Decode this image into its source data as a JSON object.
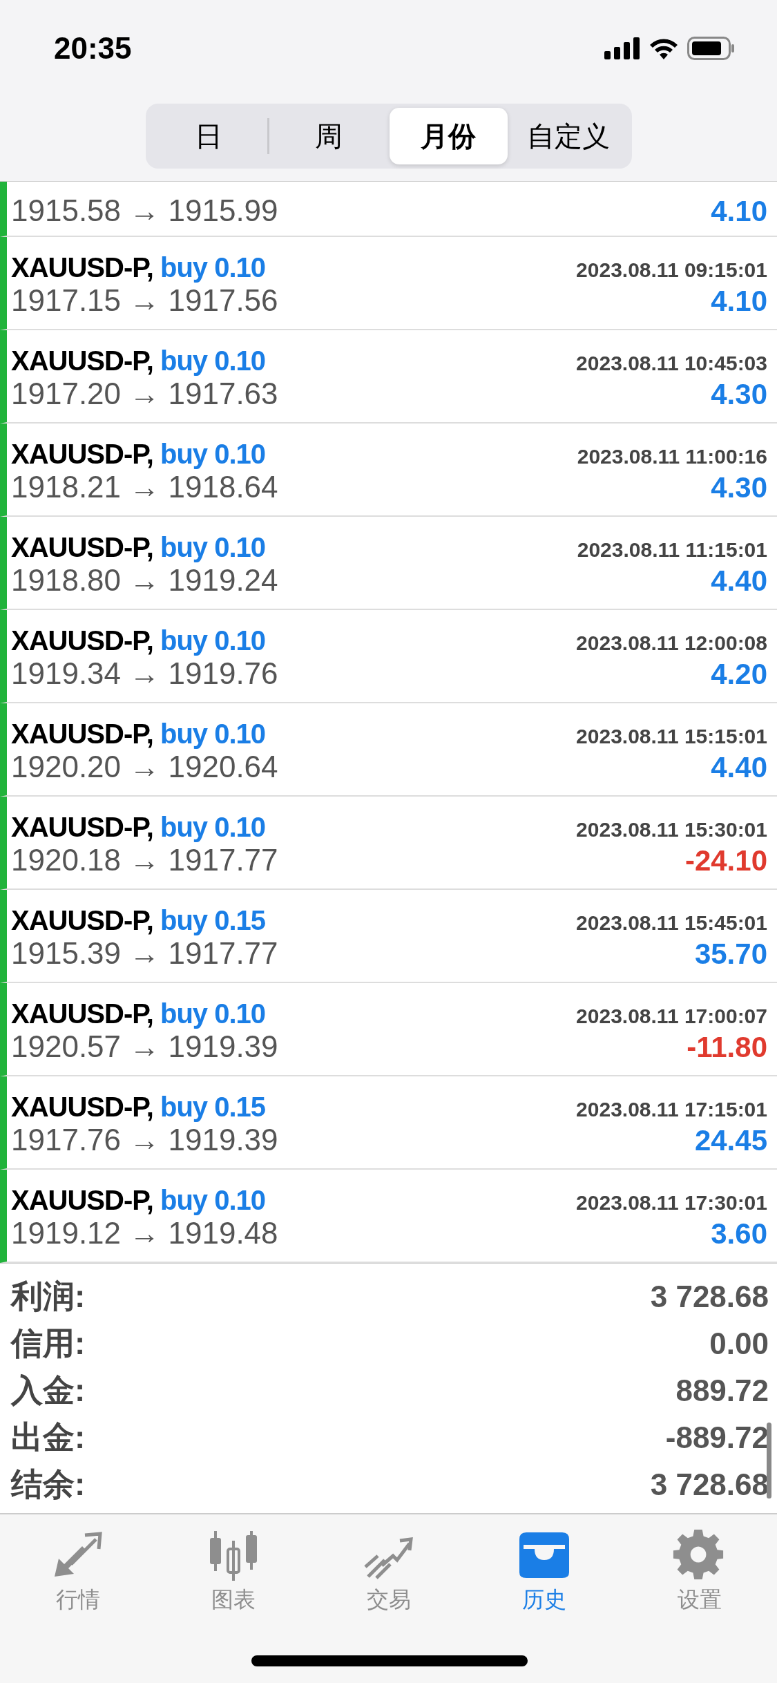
{
  "status_bar": {
    "time": "20:35"
  },
  "segments": [
    {
      "label": "日",
      "selected": false
    },
    {
      "label": "周",
      "selected": false
    },
    {
      "label": "月份",
      "selected": true
    },
    {
      "label": "自定义",
      "selected": false
    }
  ],
  "deals": [
    {
      "prices": "1915.58 → 1915.99",
      "profit": "4.10",
      "color": "#1a7ee6"
    },
    {
      "symbol": "XAUUSD-P,",
      "action": "buy 0.10",
      "time": "2023.08.11 09:15:01",
      "prices": "1917.15 → 1917.56",
      "profit": "4.10",
      "color": "#1a7ee6"
    },
    {
      "symbol": "XAUUSD-P,",
      "action": "buy 0.10",
      "time": "2023.08.11 10:45:03",
      "prices": "1917.20 → 1917.63",
      "profit": "4.30",
      "color": "#1a7ee6"
    },
    {
      "symbol": "XAUUSD-P,",
      "action": "buy 0.10",
      "time": "2023.08.11 11:00:16",
      "prices": "1918.21 → 1918.64",
      "profit": "4.30",
      "color": "#1a7ee6"
    },
    {
      "symbol": "XAUUSD-P,",
      "action": "buy 0.10",
      "time": "2023.08.11 11:15:01",
      "prices": "1918.80 → 1919.24",
      "profit": "4.40",
      "color": "#1a7ee6"
    },
    {
      "symbol": "XAUUSD-P,",
      "action": "buy 0.10",
      "time": "2023.08.11 12:00:08",
      "prices": "1919.34 → 1919.76",
      "profit": "4.20",
      "color": "#1a7ee6"
    },
    {
      "symbol": "XAUUSD-P,",
      "action": "buy 0.10",
      "time": "2023.08.11 15:15:01",
      "prices": "1920.20 → 1920.64",
      "profit": "4.40",
      "color": "#1a7ee6"
    },
    {
      "symbol": "XAUUSD-P,",
      "action": "buy 0.10",
      "time": "2023.08.11 15:30:01",
      "prices": "1920.18 → 1917.77",
      "profit": "-24.10",
      "color": "#e03a2e"
    },
    {
      "symbol": "XAUUSD-P,",
      "action": "buy 0.15",
      "time": "2023.08.11 15:45:01",
      "prices": "1915.39 → 1917.77",
      "profit": "35.70",
      "color": "#1a7ee6"
    },
    {
      "symbol": "XAUUSD-P,",
      "action": "buy 0.10",
      "time": "2023.08.11 17:00:07",
      "prices": "1920.57 → 1919.39",
      "profit": "-11.80",
      "color": "#e03a2e"
    },
    {
      "symbol": "XAUUSD-P,",
      "action": "buy 0.15",
      "time": "2023.08.11 17:15:01",
      "prices": "1917.76 → 1919.39",
      "profit": "24.45",
      "color": "#1a7ee6"
    },
    {
      "symbol": "XAUUSD-P,",
      "action": "buy 0.10",
      "time": "2023.08.11 17:30:01",
      "prices": "1919.12 → 1919.48",
      "profit": "3.60",
      "color": "#1a7ee6"
    }
  ],
  "summary": [
    {
      "label": "利润:",
      "value": "3 728.68"
    },
    {
      "label": "信用:",
      "value": "0.00"
    },
    {
      "label": "入金:",
      "value": "889.72"
    },
    {
      "label": "出金:",
      "value": "-889.72"
    },
    {
      "label": "结余:",
      "value": "3 728.68"
    }
  ],
  "tab_bar": [
    {
      "kind": "quotes",
      "label": "行情",
      "selected": false
    },
    {
      "kind": "chart",
      "label": "图表",
      "selected": false
    },
    {
      "kind": "trade",
      "label": "交易",
      "selected": false
    },
    {
      "kind": "history",
      "label": "历史",
      "selected": true
    },
    {
      "kind": "settings",
      "label": "设置",
      "selected": false
    }
  ]
}
